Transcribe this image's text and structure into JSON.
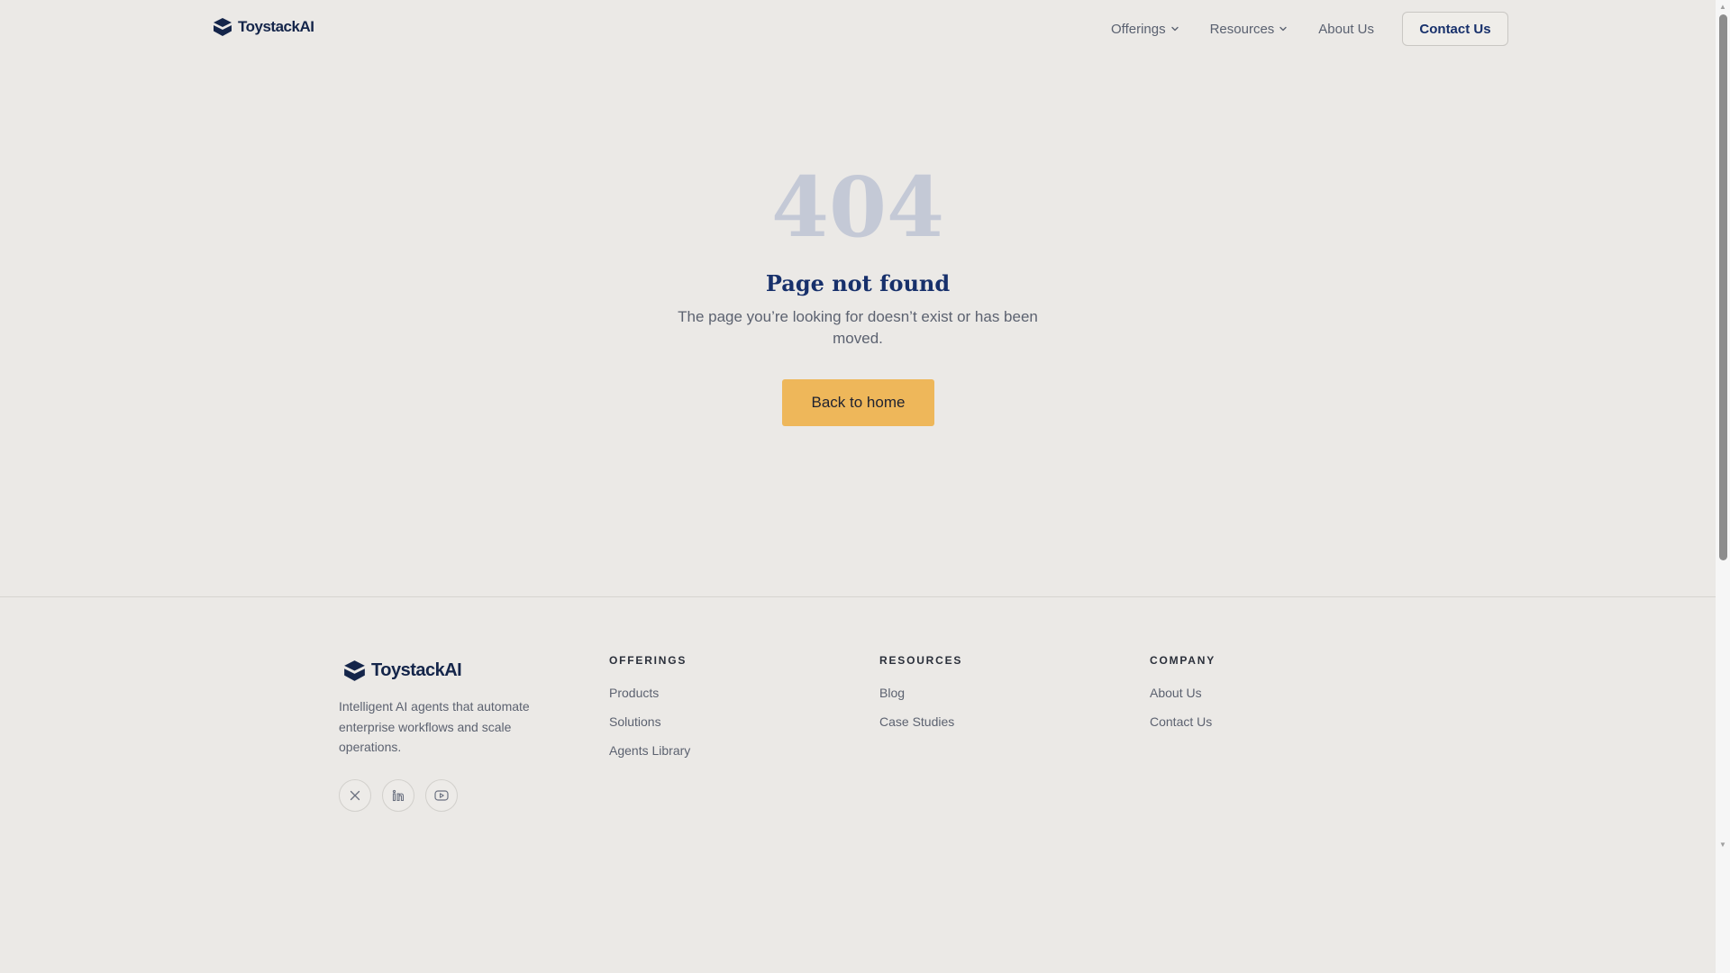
{
  "brand": {
    "name": "ToystackAI",
    "color": "#14254a"
  },
  "nav": {
    "items": [
      {
        "label": "Offerings",
        "has_dropdown": true
      },
      {
        "label": "Resources",
        "has_dropdown": true
      },
      {
        "label": "About Us",
        "has_dropdown": false
      }
    ],
    "cta_label": "Contact Us"
  },
  "error": {
    "code": "404",
    "title": "Page not found",
    "description": "The page you’re looking for doesn’t exist or has been moved.",
    "button_label": "Back to home",
    "button_color": "#eeb75a"
  },
  "footer": {
    "tagline": "Intelligent AI agents that automate enterprise workflows and scale operations.",
    "socials": [
      {
        "icon": "x-icon"
      },
      {
        "icon": "linkedin-icon"
      },
      {
        "icon": "youtube-icon"
      }
    ],
    "columns": [
      {
        "heading": "OFFERINGS",
        "links": [
          "Products",
          "Solutions",
          "Agents Library"
        ]
      },
      {
        "heading": "RESOURCES",
        "links": [
          "Blog",
          "Case Studies"
        ]
      },
      {
        "heading": "COMPANY",
        "links": [
          "About Us",
          "Contact Us"
        ]
      }
    ]
  }
}
